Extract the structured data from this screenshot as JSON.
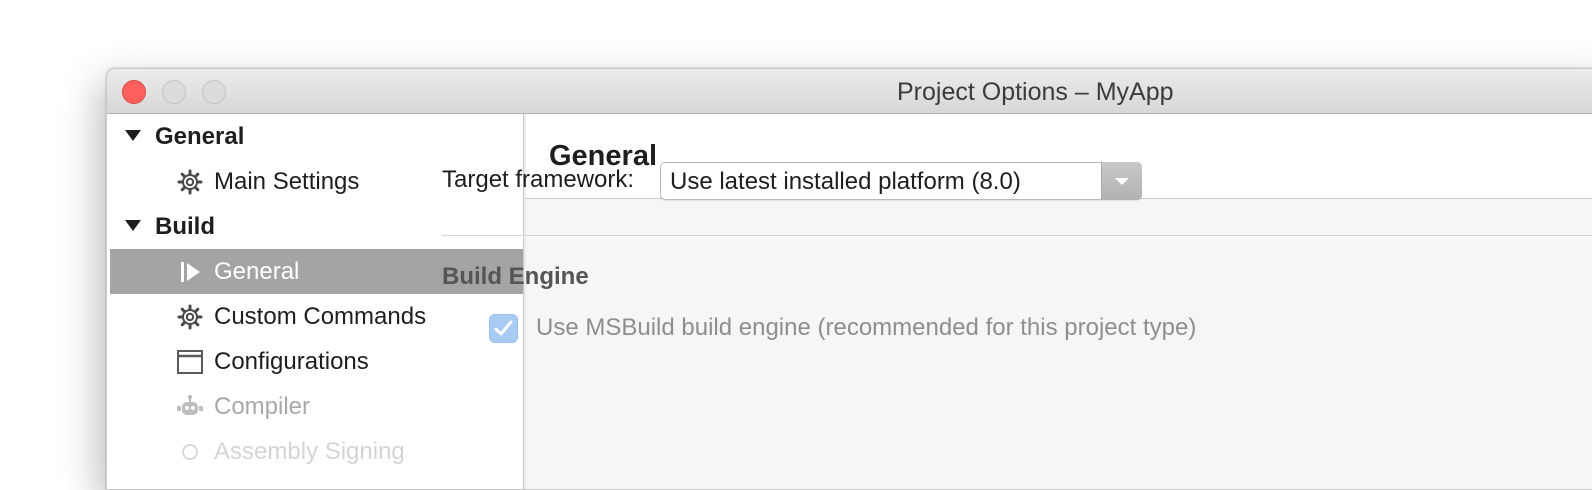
{
  "window": {
    "title": "Project Options – MyApp"
  },
  "sidebar": {
    "sections": [
      {
        "label": "General",
        "items": [
          {
            "label": "Main Settings",
            "icon": "gear-icon"
          }
        ]
      },
      {
        "label": "Build",
        "items": [
          {
            "label": "General",
            "icon": "play-bar-icon",
            "selected": true
          },
          {
            "label": "Custom Commands",
            "icon": "gear-icon"
          },
          {
            "label": "Configurations",
            "icon": "window-icon"
          },
          {
            "label": "Compiler",
            "icon": "robot-icon",
            "disabled": true
          },
          {
            "label": "Assembly Signing",
            "icon": "gear-icon",
            "disabled": true
          }
        ]
      }
    ]
  },
  "main": {
    "title": "General",
    "target_framework": {
      "label": "Target framework:",
      "value": "Use latest installed platform (8.0)"
    },
    "build_engine": {
      "title": "Build Engine",
      "checkbox_label": "Use MSBuild build engine (recommended for this project type)",
      "checked": true
    }
  },
  "colors": {
    "selected_row": "#a4a4a4",
    "close_button": "#fc605c",
    "checkbox": "#a8cbf3"
  }
}
